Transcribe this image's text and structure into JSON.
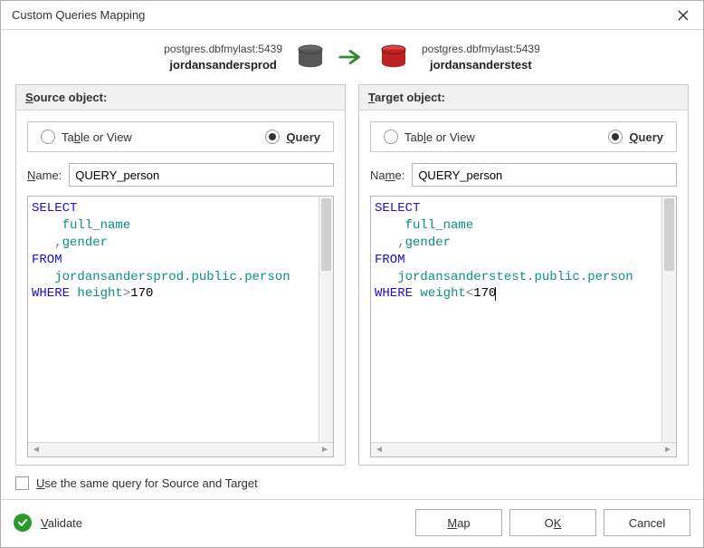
{
  "title": "Custom Queries Mapping",
  "mapping": {
    "source_conn": "postgres.dbfmylast:5439",
    "source_db": "jordansandersprod",
    "target_conn": "postgres.dbfmylast:5439",
    "target_db": "jordansanderstest"
  },
  "source_panel": {
    "heading_prefix": "S",
    "heading_rest": "ource object:",
    "radio_table_prefix": "Ta",
    "radio_table_ul": "b",
    "radio_table_rest": "le or View",
    "radio_query_ul": "Q",
    "radio_query_rest": "uery",
    "selected": "query",
    "name_label_ul": "N",
    "name_label_rest": "ame:",
    "name_value": "QUERY_person",
    "query_lines": [
      {
        "tokens": [
          {
            "t": "SELECT",
            "c": "kw"
          }
        ]
      },
      {
        "tokens": [
          {
            "t": "    ",
            "c": ""
          },
          {
            "t": "full_name",
            "c": "ident"
          }
        ]
      },
      {
        "tokens": [
          {
            "t": "   ",
            "c": ""
          },
          {
            "t": ",",
            "c": "op"
          },
          {
            "t": "gender",
            "c": "ident"
          }
        ]
      },
      {
        "tokens": [
          {
            "t": "FROM",
            "c": "kw"
          }
        ]
      },
      {
        "tokens": [
          {
            "t": "   ",
            "c": ""
          },
          {
            "t": "jordansandersprod.public.person",
            "c": "ident"
          }
        ]
      },
      {
        "tokens": [
          {
            "t": "WHERE",
            "c": "kw"
          },
          {
            "t": " ",
            "c": ""
          },
          {
            "t": "height",
            "c": "ident"
          },
          {
            "t": ">",
            "c": "op"
          },
          {
            "t": "170",
            "c": ""
          }
        ]
      }
    ]
  },
  "target_panel": {
    "heading_prefix": "T",
    "heading_rest": "arget object:",
    "radio_table_prefix": "Tab",
    "radio_table_ul": "l",
    "radio_table_rest": "e or View",
    "radio_query_ul": "Q",
    "radio_query_rest": "uery",
    "selected": "query",
    "name_label_prefix": "Na",
    "name_label_ul": "m",
    "name_label_rest": "e:",
    "name_value": "QUERY_person",
    "query_lines": [
      {
        "tokens": [
          {
            "t": "SELECT",
            "c": "kw"
          }
        ]
      },
      {
        "tokens": [
          {
            "t": "    ",
            "c": ""
          },
          {
            "t": "full_name",
            "c": "ident"
          }
        ]
      },
      {
        "tokens": [
          {
            "t": "   ",
            "c": ""
          },
          {
            "t": ",",
            "c": "op"
          },
          {
            "t": "gender",
            "c": "ident"
          }
        ]
      },
      {
        "tokens": [
          {
            "t": "FROM",
            "c": "kw"
          }
        ]
      },
      {
        "tokens": [
          {
            "t": "   ",
            "c": ""
          },
          {
            "t": "jordansanderstest.public.person",
            "c": "ident"
          }
        ]
      },
      {
        "tokens": [
          {
            "t": "WHERE",
            "c": "kw"
          },
          {
            "t": " ",
            "c": ""
          },
          {
            "t": "weight",
            "c": "ident"
          },
          {
            "t": "<",
            "c": "op"
          },
          {
            "t": "170",
            "c": ""
          }
        ]
      }
    ]
  },
  "same_query": {
    "checked": false,
    "ul": "U",
    "rest": "se the same query for Source and Target"
  },
  "footer": {
    "validate_ul": "V",
    "validate_rest": "alidate",
    "map_ul": "M",
    "map_rest": "ap",
    "ok_prefix": "O",
    "ok_ul": "K",
    "cancel": "Cancel"
  }
}
